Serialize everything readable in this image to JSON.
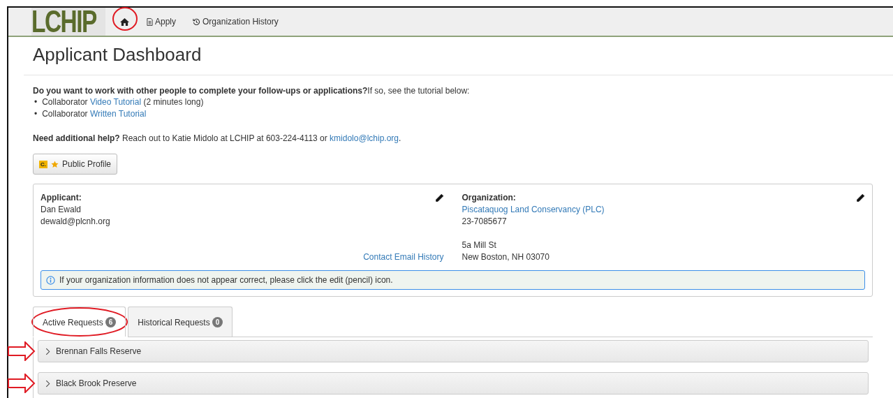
{
  "navbar": {
    "logo": "LCHIP",
    "links": [
      {
        "kind": "home"
      },
      {
        "kind": "apply",
        "label": "Apply"
      },
      {
        "kind": "history",
        "label": "Organization History"
      }
    ]
  },
  "page_title": "Applicant Dashboard",
  "intro": "**Do you want to work with other people to complete your follow-ups or applications?**If so, see the tutorial below:",
  "tutorials": [
    {
      "bullet": "•",
      "prefix": "Collaborator ",
      "link": "Video Tutorial",
      "suffix": " (2 minutes long)"
    },
    {
      "bullet": "•",
      "prefix": "Collaborator ",
      "link": "Written Tutorial"
    }
  ],
  "help": {
    "text": "**Need additional help?**  Reach out to Katie Midolo at LCHIP at 603-224-4113 or ",
    "link": "kmidolo@lchip.org",
    "end": "."
  },
  "public_profile_button": {
    "badge": "C.",
    "label": "Public Profile"
  },
  "applicant": {
    "label": "Applicant:",
    "name": "Dan Ewald",
    "email": "dewald@plcnh.org",
    "contact_link": "Contact Email History"
  },
  "organization": {
    "label": "Organization:",
    "name": "Piscataquog Land Conservancy (PLC)",
    "ein": "23-7085677",
    "street": "5a Mill St",
    "city": "New Boston, NH 03070"
  },
  "info_alert": "If your organization information does not appear correct, please click the edit (pencil) icon.",
  "tabs": [
    {
      "label": "Active Requests",
      "count": "6",
      "selected": true
    },
    {
      "label": "Historical Requests",
      "count": "0",
      "selected": false
    }
  ],
  "requests": [
    {
      "title": "Brennan Falls Reserve",
      "expanded": false
    },
    {
      "title": "Black Brook Preserve",
      "expanded": false
    }
  ]
}
